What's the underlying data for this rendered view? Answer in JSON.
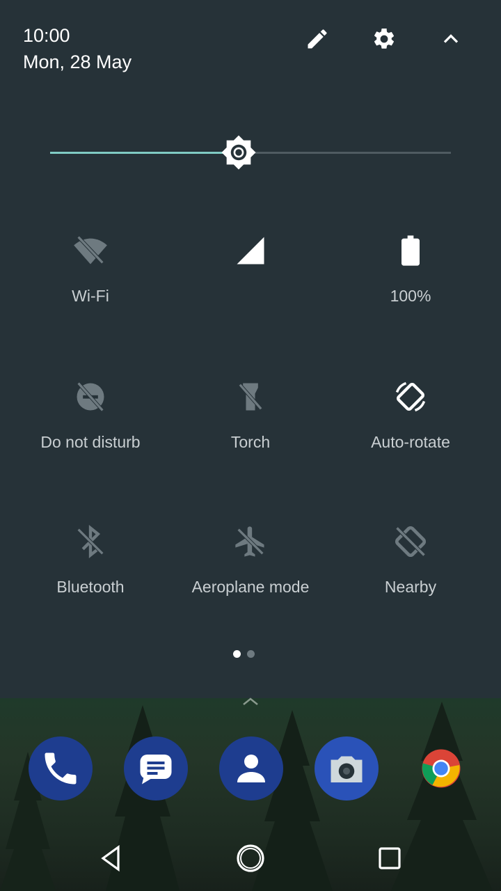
{
  "header": {
    "time": "10:00",
    "date": "Mon, 28 May"
  },
  "brightness": {
    "level": 0.47
  },
  "tiles": [
    {
      "label": "Wi-Fi",
      "icon": "wifi-off-icon",
      "active": false
    },
    {
      "label": "",
      "icon": "cell-signal-icon",
      "active": true
    },
    {
      "label": "100%",
      "icon": "battery-full-icon",
      "active": true
    },
    {
      "label": "Do not disturb",
      "icon": "do-not-disturb-off-icon",
      "active": false
    },
    {
      "label": "Torch",
      "icon": "torch-off-icon",
      "active": false
    },
    {
      "label": "Auto-rotate",
      "icon": "auto-rotate-icon",
      "active": true
    },
    {
      "label": "Bluetooth",
      "icon": "bluetooth-off-icon",
      "active": false
    },
    {
      "label": "Aeroplane mode",
      "icon": "airplane-off-icon",
      "active": false
    },
    {
      "label": "Nearby",
      "icon": "nearby-off-icon",
      "active": false
    }
  ],
  "pager": {
    "pages": 2,
    "current": 1
  },
  "dock": [
    "phone-icon",
    "messages-icon",
    "contacts-icon",
    "camera-icon",
    "chrome-icon"
  ],
  "nav": [
    "back-icon",
    "home-icon",
    "recents-icon"
  ],
  "colors": {
    "panel_bg": "#263238",
    "accent": "#80cbc4",
    "tile_off": "#6e7a80",
    "tile_on": "#ffffff"
  }
}
